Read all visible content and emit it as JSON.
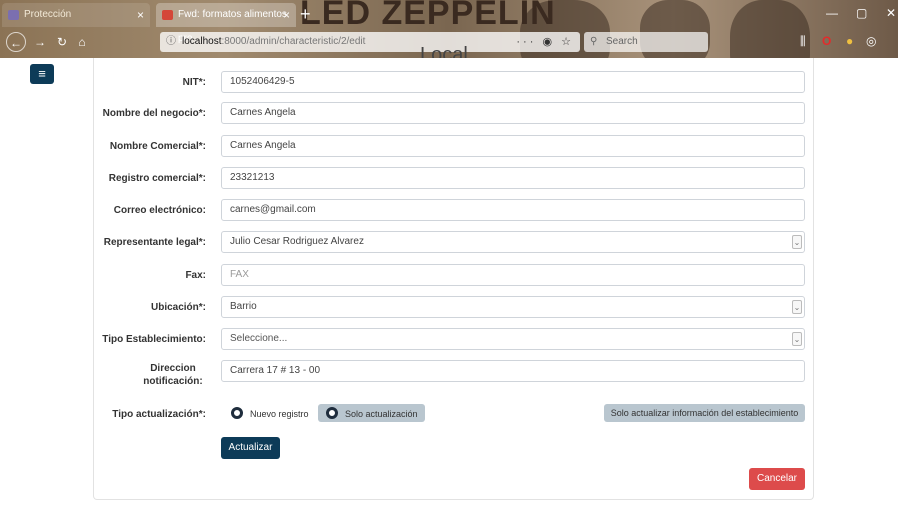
{
  "browser": {
    "tabs": [
      {
        "title": "Protección",
        "active": false
      },
      {
        "title": "Fwd: formatos alimentos pro",
        "active": true
      }
    ],
    "banner_text": "LED ZEPPELIN",
    "url": {
      "host": "localhost",
      "rest": ":8000/admin/characteristic/2/edit"
    },
    "search_placeholder": "Search",
    "url_dots": "···"
  },
  "page": {
    "heading": "Local",
    "menu_icon": "menu-icon"
  },
  "form": {
    "fields": [
      {
        "label": "NIT*:",
        "value": "1052406429-5",
        "kind": "text"
      },
      {
        "label": "Nombre del negocio*:",
        "value": "Carnes Angela",
        "kind": "text"
      },
      {
        "label": "Nombre Comercial*:",
        "value": "Carnes Angela",
        "kind": "text"
      },
      {
        "label": "Registro comercial*:",
        "value": "23321213",
        "kind": "text"
      },
      {
        "label": "Correo electrónico:",
        "value": "carnes@gmail.com",
        "kind": "text"
      },
      {
        "label": "Representante legal*:",
        "value": "Julio Cesar Rodriguez Alvarez",
        "kind": "select"
      },
      {
        "label": "Fax:",
        "placeholder": "FAX",
        "kind": "text"
      },
      {
        "label": "Ubicación*:",
        "value": "Barrio",
        "kind": "select"
      },
      {
        "label": "Tipo Establecimiento:",
        "value": "Seleccione...",
        "kind": "select"
      },
      {
        "label": "Direccion notificación:",
        "value": "Carrera 17 # 13 - 00",
        "kind": "text"
      }
    ],
    "update_type": {
      "label": "Tipo actualización*:",
      "option_new": "Nuevo registro",
      "option_update": "Solo actualización",
      "info_button": "Solo actualizar información del establecimiento"
    },
    "submit_label": "Actualizar",
    "cancel_label": "Cancelar"
  },
  "colors": {
    "primary": "#0d3b58",
    "danger": "#dd4b4b",
    "segment": "#b9c6cf"
  }
}
